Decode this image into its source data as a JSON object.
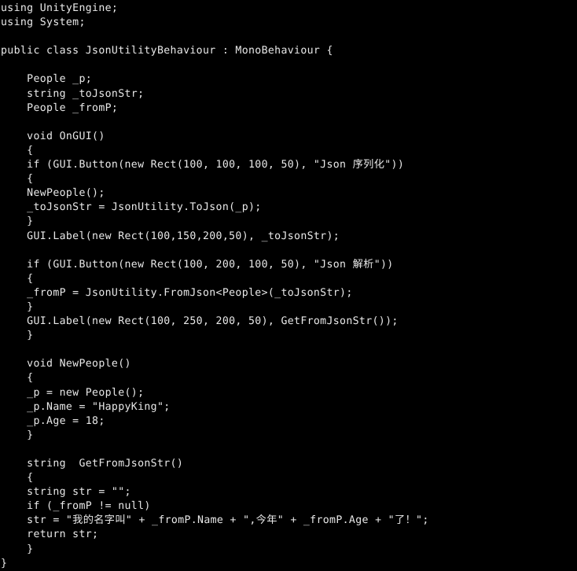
{
  "editor": {
    "language": "csharp",
    "background_color": "#000000",
    "text_color": "#e8e8e8",
    "font_size_px": 13,
    "line_height_px": 18
  },
  "code": {
    "lines": [
      "using UnityEngine;",
      "using System;",
      "",
      "public class JsonUtilityBehaviour : MonoBehaviour {",
      "",
      "    People _p;",
      "    string _toJsonStr;",
      "    People _fromP;",
      "",
      "    void OnGUI()",
      "    {",
      "    if (GUI.Button(new Rect(100, 100, 100, 50), \"Json 序列化\"))",
      "    {",
      "    NewPeople();",
      "    _toJsonStr = JsonUtility.ToJson(_p);",
      "    }",
      "    GUI.Label(new Rect(100,150,200,50), _toJsonStr);",
      "",
      "    if (GUI.Button(new Rect(100, 200, 100, 50), \"Json 解析\"))",
      "    {",
      "    _fromP = JsonUtility.FromJson<People>(_toJsonStr);",
      "    }",
      "    GUI.Label(new Rect(100, 250, 200, 50), GetFromJsonStr());",
      "    }",
      "",
      "    void NewPeople()",
      "    {",
      "    _p = new People();",
      "    _p.Name = \"HappyKing\";",
      "    _p.Age = 18;",
      "    }",
      "",
      "    string  GetFromJsonStr()",
      "    {",
      "    string str = \"\";",
      "    if (_fromP != null)",
      "    str = \"我的名字叫\" + _fromP.Name + \",今年\" + _fromP.Age + \"了！\";",
      "    return str;",
      "    }",
      "}"
    ]
  }
}
